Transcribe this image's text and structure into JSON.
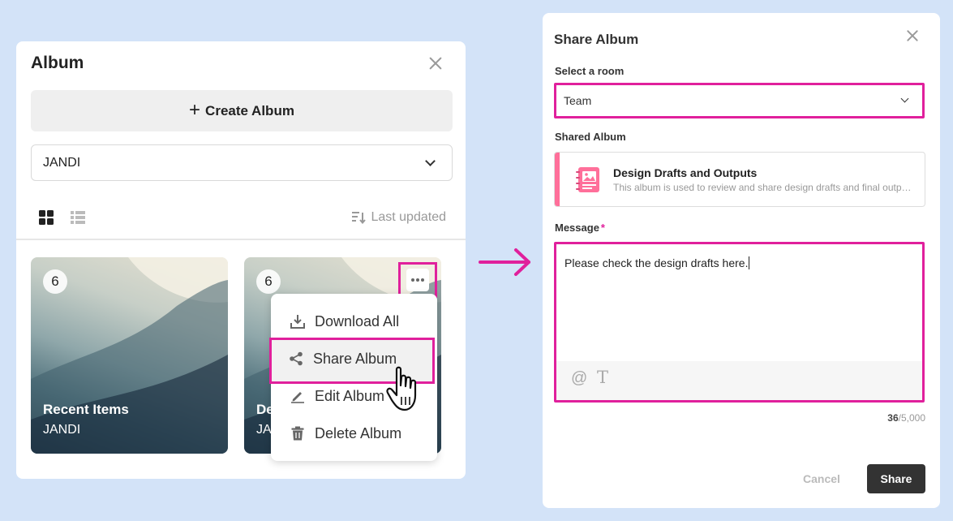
{
  "album_panel": {
    "title": "Album",
    "create_button_label": "Create Album",
    "room_select_value": "JANDI",
    "sort_label": "Last updated",
    "cards": [
      {
        "count": "6",
        "name": "Recent Items",
        "room": "JANDI"
      },
      {
        "count": "6",
        "name": "De",
        "room": "JA"
      }
    ],
    "context_menu": {
      "items": [
        {
          "label": "Download All",
          "icon": "download-icon"
        },
        {
          "label": "Share Album",
          "icon": "share-icon"
        },
        {
          "label": "Edit Album",
          "icon": "pencil-icon"
        },
        {
          "label": "Delete Album",
          "icon": "trash-icon"
        }
      ]
    }
  },
  "share_dialog": {
    "title": "Share Album",
    "room_label": "Select a room",
    "room_value": "Team",
    "shared_album_label": "Shared Album",
    "album_name": "Design Drafts and Outputs",
    "album_description": "This album is used to review and share design drafts and final outputs.",
    "message_label": "Message",
    "required_mark": "*",
    "message_value": "Please check the design drafts here.",
    "char_count": "36",
    "char_limit": "/5,000",
    "cancel_label": "Cancel",
    "share_label": "Share"
  },
  "colors": {
    "highlight": "#e0209c",
    "album_accent": "#ff6f9a",
    "background": "#d3e3f8"
  }
}
